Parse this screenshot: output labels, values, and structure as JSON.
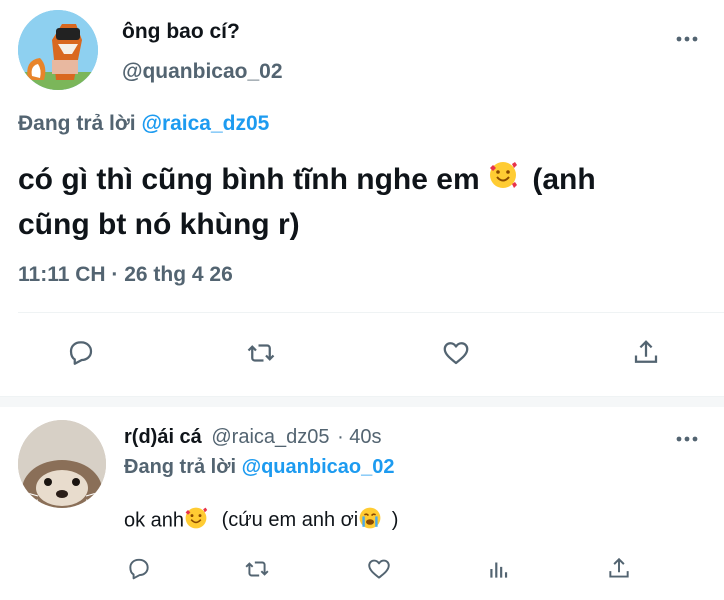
{
  "main_tweet": {
    "author_name": "ông bao cí?",
    "author_handle": "@quanbicao_02",
    "replying_prefix": "Đang trả lời",
    "replying_to": "@raica_dz05",
    "text_line1": "có gì thì cũng bình tĩnh nghe em",
    "text_line1_after": "(anh",
    "text_line2": "cũng bt nó khùng r)",
    "timestamp": "11:11 CH · 26 thg 4 26",
    "icons": [
      "reply-icon",
      "retweet-icon",
      "like-icon",
      "share-icon"
    ]
  },
  "reply_tweet": {
    "author_name": "r(d)ái cá",
    "author_handle": "@raica_dz05",
    "time": "· 40s",
    "replying_prefix": "Đang trả lời",
    "replying_to": "@quanbicao_02",
    "text_before": "ok anh",
    "text_middle": "(cứu em anh ơi",
    "text_end": ")",
    "icons": [
      "reply-icon",
      "retweet-icon",
      "like-icon",
      "analytics-icon",
      "share-icon"
    ]
  },
  "colors": {
    "link": "#1d9bf0",
    "muted": "#536471",
    "text": "#0f1419",
    "divider": "#eff3f4"
  }
}
